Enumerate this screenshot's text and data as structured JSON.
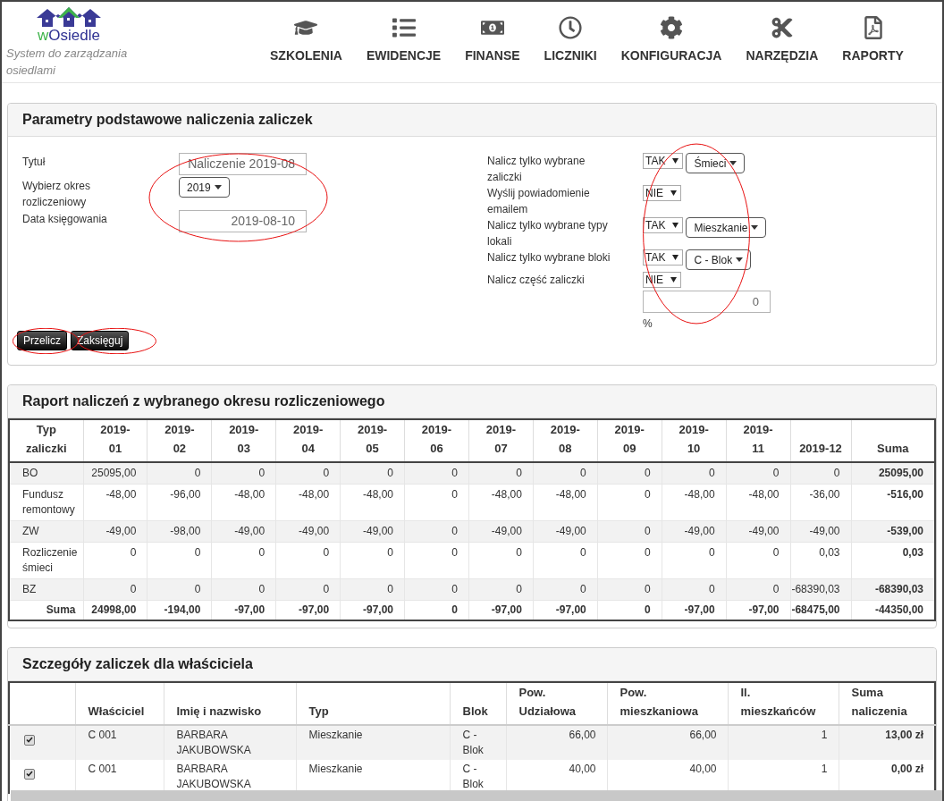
{
  "logo": {
    "prefix": "w",
    "name": "Osiedle",
    "tagline": "System do zarządzania osiedlami"
  },
  "nav": [
    {
      "label": "SZKOLENIA"
    },
    {
      "label": "EWIDENCJE"
    },
    {
      "label": "FINANSE"
    },
    {
      "label": "LICZNIKI"
    },
    {
      "label": "KONFIGURACJA"
    },
    {
      "label": "NARZĘDZIA"
    },
    {
      "label": "RAPORTY"
    }
  ],
  "params": {
    "title": "Parametry podstawowe naliczenia zaliczek",
    "left": [
      {
        "label": "Tytuł",
        "controls": [
          {
            "kind": "input",
            "value": "Naliczenie 2019-08"
          }
        ]
      },
      {
        "label": "Wybierz okres rozliczeniowy",
        "controls": [
          {
            "kind": "dropdown",
            "value": "2019"
          }
        ]
      },
      {
        "label": "Data księgowania",
        "controls": [
          {
            "kind": "input",
            "value": "2019-08-10"
          }
        ]
      }
    ],
    "right": [
      {
        "label": "Nalicz tylko wybrane zaliczki",
        "controls": [
          {
            "kind": "select",
            "value": "TAK"
          },
          {
            "kind": "dropdown",
            "value": "Śmieci"
          }
        ]
      },
      {
        "label": "Wyślij powiadomienie emailem",
        "controls": [
          {
            "kind": "select",
            "value": "NIE"
          }
        ]
      },
      {
        "label": "Nalicz tylko wybrane typy lokali",
        "controls": [
          {
            "kind": "select",
            "value": "TAK"
          },
          {
            "kind": "dropdown",
            "value": "Mieszkanie"
          }
        ]
      },
      {
        "label": "Nalicz tylko wybrane bloki",
        "controls": [
          {
            "kind": "select",
            "value": "TAK"
          },
          {
            "kind": "dropdown",
            "value": "C - Blok"
          }
        ]
      },
      {
        "label": "Nalicz część zaliczki",
        "controls": [
          {
            "kind": "select",
            "value": "NIE"
          },
          {
            "kind": "input",
            "value": "0"
          },
          {
            "kind": "unit",
            "value": "%"
          }
        ]
      }
    ],
    "buttons": [
      "Przelicz",
      "Zaksięguj"
    ]
  },
  "report": {
    "title": "Raport naliczeń z wybranego okresu rozliczeniowego",
    "columns": [
      "Typ zaliczki",
      "2019-01",
      "2019-02",
      "2019-03",
      "2019-04",
      "2019-05",
      "2019-06",
      "2019-07",
      "2019-08",
      "2019-09",
      "2019-10",
      "2019-11",
      "2019-12",
      "Suma"
    ],
    "rows": [
      [
        "BO",
        "25095,00",
        "0",
        "0",
        "0",
        "0",
        "0",
        "0",
        "0",
        "0",
        "0",
        "0",
        "0",
        "25095,00"
      ],
      [
        "Fundusz remontowy",
        "-48,00",
        "-96,00",
        "-48,00",
        "-48,00",
        "-48,00",
        "0",
        "-48,00",
        "-48,00",
        "0",
        "-48,00",
        "-48,00",
        "-36,00",
        "-516,00"
      ],
      [
        "ZW",
        "-49,00",
        "-98,00",
        "-49,00",
        "-49,00",
        "-49,00",
        "0",
        "-49,00",
        "-49,00",
        "0",
        "-49,00",
        "-49,00",
        "-49,00",
        "-539,00"
      ],
      [
        "Rozliczenie śmieci",
        "0",
        "0",
        "0",
        "0",
        "0",
        "0",
        "0",
        "0",
        "0",
        "0",
        "0",
        "0,03",
        "0,03"
      ],
      [
        "BZ",
        "0",
        "0",
        "0",
        "0",
        "0",
        "0",
        "0",
        "0",
        "0",
        "0",
        "0",
        "-68390,03",
        "-68390,03"
      ]
    ],
    "total": [
      "Suma",
      "24998,00",
      "-194,00",
      "-97,00",
      "-97,00",
      "-97,00",
      "0",
      "-97,00",
      "-97,00",
      "0",
      "-97,00",
      "-97,00",
      "-68475,00",
      "-44350,00"
    ]
  },
  "details": {
    "title": "Szczegóły zaliczek dla właściciela",
    "columns": [
      "Właściciel",
      "Imię i nazwisko",
      "Typ",
      "Blok",
      "Pow. Udziałowa",
      "Pow. mieszkaniowa",
      "Il. mieszkańców",
      "Suma naliczenia"
    ],
    "rows": [
      {
        "checked": true,
        "cells": [
          "C 001",
          "BARBARA JAKUBOWSKA",
          "Mieszkanie",
          "C - Blok",
          "66,00",
          "66,00",
          "1",
          "13,00 zł"
        ]
      },
      {
        "checked": true,
        "cells": [
          "C 001",
          "BARBARA JAKUBOWSKA",
          "Mieszkanie",
          "C - Blok",
          "40,00",
          "40,00",
          "1",
          "0,00 zł"
        ]
      }
    ]
  }
}
